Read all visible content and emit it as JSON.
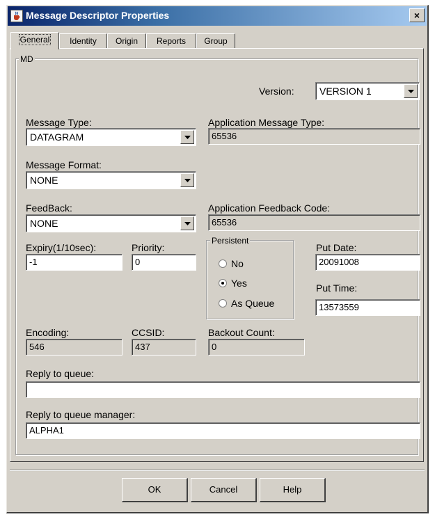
{
  "window": {
    "title": "Message Descriptor Properties",
    "close_glyph": "×"
  },
  "tabs": [
    {
      "label": "General",
      "active": true
    },
    {
      "label": "Identity",
      "active": false
    },
    {
      "label": "Origin",
      "active": false
    },
    {
      "label": "Reports",
      "active": false
    },
    {
      "label": "Group",
      "active": false
    }
  ],
  "md_group": {
    "legend": "MD"
  },
  "version": {
    "label": "Version:",
    "value": "VERSION 1"
  },
  "message_type": {
    "label": "Message Type:",
    "value": "DATAGRAM"
  },
  "application_message_type": {
    "label": "Application Message Type:",
    "value": "65536"
  },
  "message_format": {
    "label": "Message Format:",
    "value": "NONE"
  },
  "feedback": {
    "label": "FeedBack:",
    "value": "NONE"
  },
  "application_feedback_code": {
    "label": "Application Feedback Code:",
    "value": "65536"
  },
  "expiry": {
    "label": "Expiry(1/10sec):",
    "value": "-1"
  },
  "priority": {
    "label": "Priority:",
    "value": "0"
  },
  "persistent": {
    "legend": "Persistent",
    "options": [
      {
        "label": "No",
        "checked": false
      },
      {
        "label": "Yes",
        "checked": true
      },
      {
        "label": "As Queue",
        "checked": false
      }
    ]
  },
  "put_date": {
    "label": "Put Date:",
    "value": "20091008"
  },
  "put_time": {
    "label": "Put Time:",
    "value": "13573559"
  },
  "encoding": {
    "label": "Encoding:",
    "value": "546"
  },
  "ccsid": {
    "label": "CCSID:",
    "value": "437"
  },
  "backout_count": {
    "label": "Backout Count:",
    "value": "0"
  },
  "reply_to_queue": {
    "label": "Reply to queue:",
    "value": ""
  },
  "reply_to_queue_manager": {
    "label": "Reply to queue manager:",
    "value": "ALPHA1"
  },
  "buttons": {
    "ok": "OK",
    "cancel": "Cancel",
    "help": "Help"
  },
  "colors": {
    "title_start": "#0a246a",
    "title_end": "#a6caf0",
    "face": "#d4d0c8"
  },
  "icons": {
    "app": "java-cup-icon",
    "close": "close-icon",
    "dropdown": "chevron-down-icon"
  }
}
